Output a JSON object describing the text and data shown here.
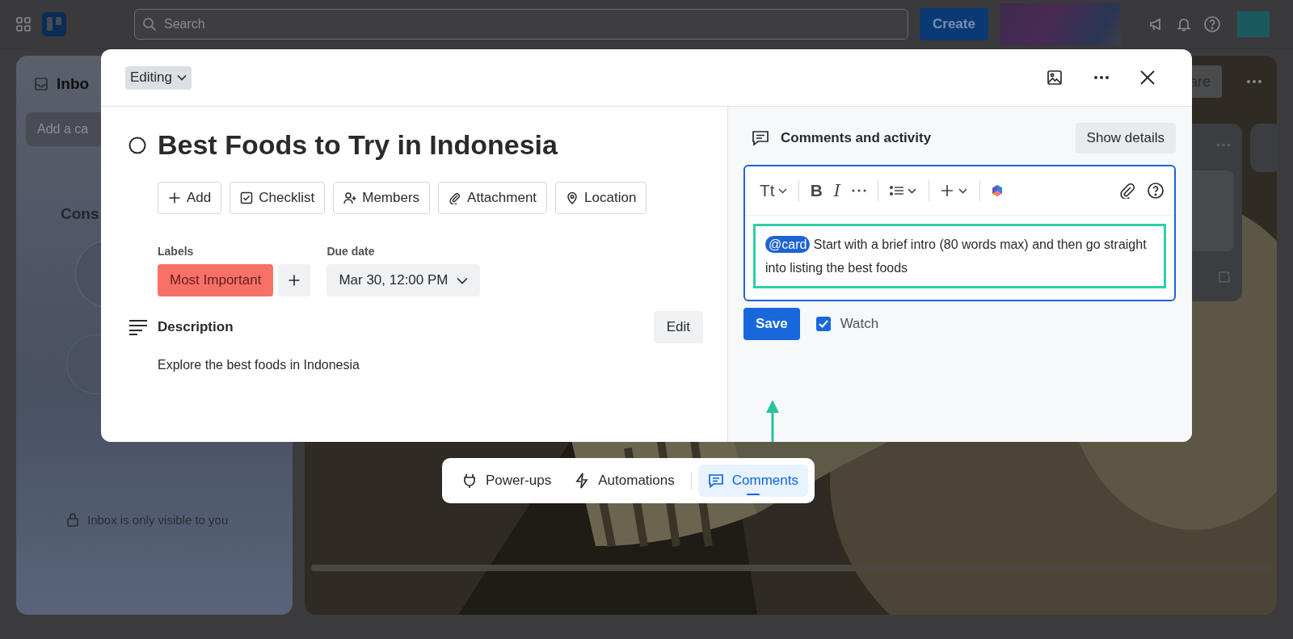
{
  "topbar": {
    "search": {
      "placeholder": "Search"
    },
    "create_button": "Create"
  },
  "inbox": {
    "title": "Inbo",
    "add_card": {
      "placeholder": "Add a ca"
    },
    "heading": "Cons",
    "footer": "Inbox is only visible to you"
  },
  "board": {
    "share_button": "are"
  },
  "card": {
    "mode": "Editing",
    "title": "Best Foods to Try in Indonesia",
    "completed": false,
    "actions": [
      {
        "label": "Add",
        "kind": "plus"
      },
      {
        "label": "Checklist",
        "kind": "checklist"
      },
      {
        "label": "Members",
        "kind": "member"
      },
      {
        "label": "Attachment",
        "kind": "attachment"
      },
      {
        "label": "Location",
        "kind": "location"
      }
    ],
    "labels_heading": "Labels",
    "labels": [
      {
        "name": "Most Important",
        "color": "#f87168"
      }
    ],
    "due_date_heading": "Due date",
    "due_date": "Mar 30, 12:00 PM",
    "description_heading": "Description",
    "edit_button": "Edit",
    "description": "Explore the best foods in Indonesia"
  },
  "comments": {
    "heading": "Comments and activity",
    "show_details": "Show details",
    "toolbar": {
      "text_style": "Tt",
      "bold": "B",
      "italic": "I"
    },
    "comment": {
      "mention": "@card",
      "text": "Start with a brief intro (80 words max) and then go straight into listing the best foods"
    },
    "save_button": "Save",
    "watch": {
      "label": "Watch",
      "checked": true
    }
  },
  "bottom_bar": [
    {
      "label": "Power-ups",
      "kind": "plug",
      "selected": false
    },
    {
      "label": "Automations",
      "kind": "bolt",
      "selected": false
    },
    {
      "label": "Comments",
      "kind": "comment",
      "selected": true
    }
  ]
}
